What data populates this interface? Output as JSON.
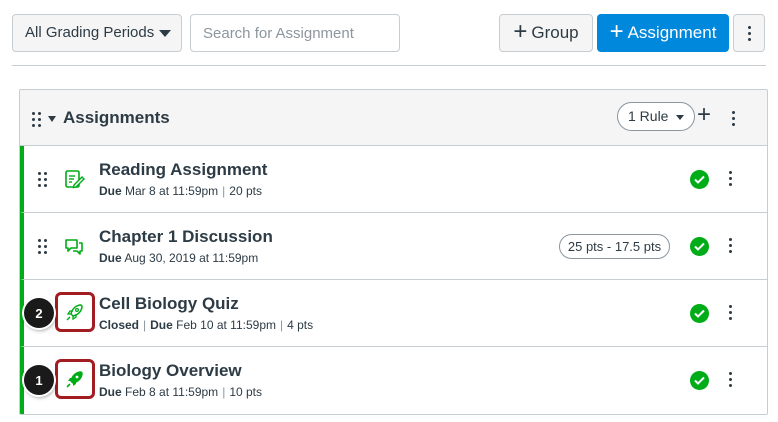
{
  "toolbar": {
    "grading_period": "All Grading Periods",
    "search_placeholder": "Search for Assignment",
    "group_button": "Group",
    "assignment_button": "Assignment"
  },
  "group": {
    "title": "Assignments",
    "rule_label": "1 Rule"
  },
  "rows": [
    {
      "title": "Reading Assignment",
      "due_label": "Due",
      "due_value": " Mar 8 at 11:59pm",
      "points": "20 pts",
      "type_icon": "assignment-icon"
    },
    {
      "title": "Chapter 1 Discussion",
      "due_label": "Due",
      "due_value": " Aug 30, 2019 at 11:59pm",
      "points_range": "25 pts - 17.5 pts",
      "type_icon": "discussion-icon"
    },
    {
      "title": "Cell Biology Quiz",
      "status": "Closed",
      "due_label": "Due",
      "due_value": " Feb 10 at 11:59pm",
      "points": "4 pts",
      "type_icon": "quiz-icon"
    },
    {
      "title": "Biology Overview",
      "due_label": "Due",
      "due_value": " Feb 8 at 11:59pm",
      "points": "10 pts",
      "type_icon": "quiz-icon"
    }
  ],
  "callouts": [
    "2",
    "1"
  ],
  "colors": {
    "accent": "#0088dd",
    "published": "#00ac18",
    "highlight": "#a21d22"
  }
}
